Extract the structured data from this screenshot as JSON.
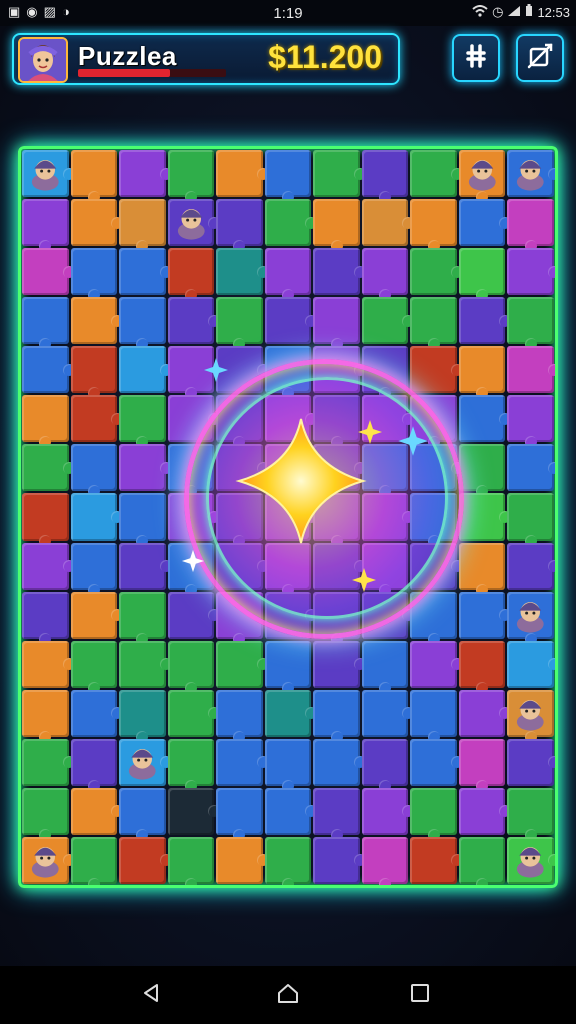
{
  "status_bar": {
    "time": "1:19",
    "battery_text": "12:53",
    "left_icons": [
      "gallery-icon",
      "notification-icon",
      "image-icon",
      "alert-icon"
    ],
    "right_icons": [
      "wifi-icon",
      "alarm-icon",
      "signal-icon",
      "battery-icon"
    ]
  },
  "hud": {
    "player_name": "Puzzlea",
    "coins": "$11.200",
    "progress_fraction": 0.62,
    "buttons": [
      {
        "name": "shuffle-button",
        "icon": "shuffle-icon"
      },
      {
        "name": "hint-button",
        "icon": "crossed-box-icon"
      }
    ]
  },
  "board": {
    "rows": 15,
    "cols": 11,
    "center_icon": "glowing-star-icon",
    "palette": {
      "purple": "#8a3fd6",
      "violet": "#5b3cc4",
      "blue": "#2e6fd8",
      "sky": "#2b9be0",
      "green": "#2fae4a",
      "lime": "#3ec54a",
      "orange": "#e88a2a",
      "amber": "#d98e37",
      "red": "#c23b22",
      "magenta": "#c33fbf",
      "teal": "#1e8f8a",
      "dark": "#1c2a36"
    },
    "tiles": [
      [
        "sky",
        "orange",
        "purple",
        "green",
        "orange",
        "blue",
        "green",
        "violet",
        "green",
        "orange",
        "blue"
      ],
      [
        "purple",
        "orange",
        "amber",
        "violet",
        "violet",
        "green",
        "orange",
        "amber",
        "orange",
        "blue",
        "magenta"
      ],
      [
        "magenta",
        "blue",
        "blue",
        "red",
        "teal",
        "purple",
        "violet",
        "purple",
        "green",
        "lime",
        "purple"
      ],
      [
        "blue",
        "orange",
        "blue",
        "violet",
        "green",
        "violet",
        "purple",
        "green",
        "green",
        "violet",
        "green"
      ],
      [
        "blue",
        "red",
        "sky",
        "purple",
        "violet",
        "blue",
        "purple",
        "violet",
        "red",
        "orange",
        "magenta"
      ],
      [
        "orange",
        "red",
        "green",
        "purple",
        "violet",
        "purple",
        "violet",
        "purple",
        "purple",
        "blue",
        "purple"
      ],
      [
        "green",
        "blue",
        "purple",
        "blue",
        "violet",
        "purple",
        "violet",
        "blue",
        "blue",
        "green",
        "blue"
      ],
      [
        "red",
        "sky",
        "blue",
        "purple",
        "violet",
        "purple",
        "purple",
        "purple",
        "blue",
        "lime",
        "green"
      ],
      [
        "purple",
        "blue",
        "violet",
        "blue",
        "violet",
        "purple",
        "violet",
        "purple",
        "violet",
        "orange",
        "violet"
      ],
      [
        "violet",
        "orange",
        "green",
        "violet",
        "purple",
        "violet",
        "violet",
        "violet",
        "blue",
        "blue",
        "blue"
      ],
      [
        "orange",
        "green",
        "green",
        "green",
        "green",
        "blue",
        "violet",
        "blue",
        "purple",
        "red",
        "sky"
      ],
      [
        "orange",
        "blue",
        "teal",
        "green",
        "blue",
        "teal",
        "blue",
        "blue",
        "blue",
        "purple",
        "amber"
      ],
      [
        "green",
        "violet",
        "sky",
        "green",
        "blue",
        "blue",
        "blue",
        "violet",
        "blue",
        "magenta",
        "violet"
      ],
      [
        "green",
        "orange",
        "blue",
        "dark",
        "blue",
        "blue",
        "violet",
        "purple",
        "green",
        "purple",
        "green"
      ],
      [
        "orange",
        "green",
        "red",
        "green",
        "orange",
        "green",
        "violet",
        "magenta",
        "red",
        "green",
        "lime"
      ]
    ],
    "characters": [
      {
        "row": 0,
        "col": 0,
        "icon": "bird-character-icon"
      },
      {
        "row": 0,
        "col": 9,
        "icon": "fox-character-icon"
      },
      {
        "row": 0,
        "col": 10,
        "icon": "ghost-character-icon"
      },
      {
        "row": 1,
        "col": 3,
        "icon": "hooded-character-icon"
      },
      {
        "row": 9,
        "col": 10,
        "icon": "creature-character-icon"
      },
      {
        "row": 11,
        "col": 10,
        "icon": "blonde-character-icon"
      },
      {
        "row": 12,
        "col": 2,
        "icon": "dwarf-character-icon"
      },
      {
        "row": 14,
        "col": 0,
        "icon": "wolf-character-icon"
      },
      {
        "row": 14,
        "col": 10,
        "icon": "knight-character-icon"
      }
    ]
  },
  "nav_bar": {
    "buttons": [
      {
        "name": "back-button",
        "icon": "triangle-back-icon"
      },
      {
        "name": "home-button",
        "icon": "home-outline-icon"
      },
      {
        "name": "recents-button",
        "icon": "square-recents-icon"
      }
    ]
  },
  "colors": {
    "hud_border": "#2ee6ff",
    "board_border": "#4bff70",
    "coin_text": "#ffe23c",
    "progress": "#e1242f"
  }
}
